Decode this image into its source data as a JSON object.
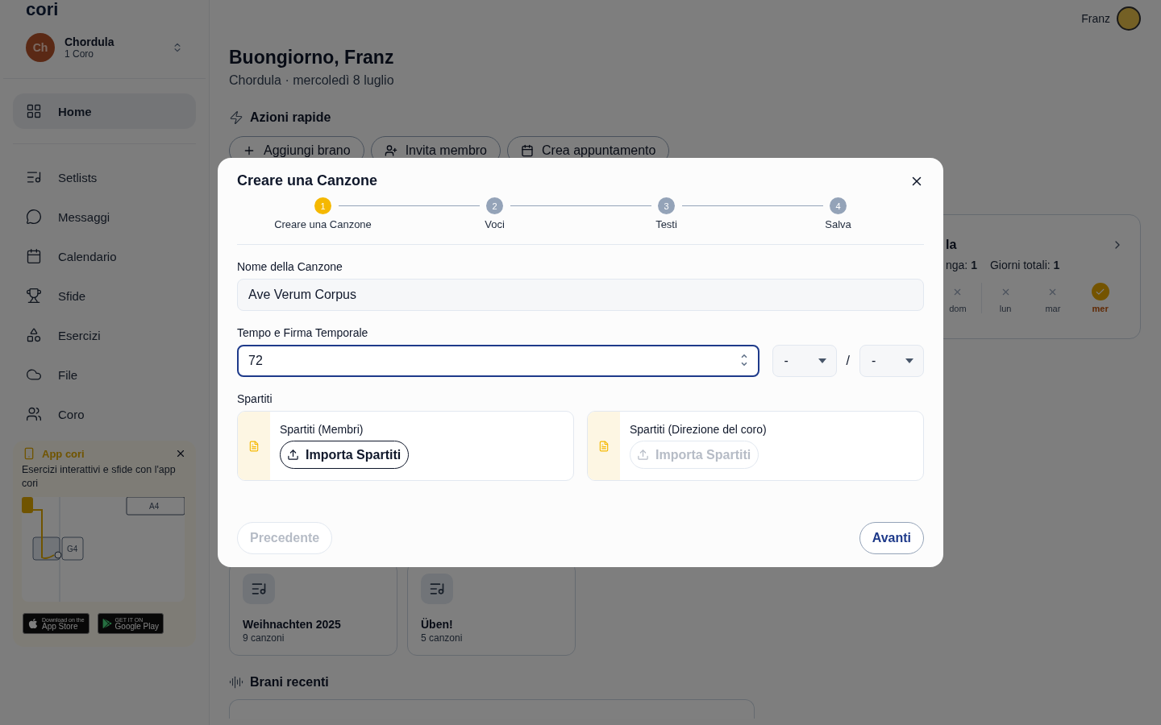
{
  "logo": "cori",
  "workspace": {
    "initials": "Ch",
    "name": "Chordula",
    "subtitle": "1 Coro"
  },
  "nav": [
    {
      "label": "Home",
      "selected": true
    },
    {
      "label": "Setlists",
      "selected": false
    },
    {
      "label": "Messaggi",
      "selected": false
    },
    {
      "label": "Calendario",
      "selected": false
    },
    {
      "label": "Sfide",
      "selected": false
    },
    {
      "label": "Esercizi",
      "selected": false
    },
    {
      "label": "File",
      "selected": false
    },
    {
      "label": "Coro",
      "selected": false
    }
  ],
  "promo": {
    "title": "App cori",
    "text": "Esercizi interattivi e sfide con l'app cori",
    "illustration_labels": [
      "A4",
      "G4"
    ],
    "stores": [
      {
        "kind": "apple",
        "small": "Download on the",
        "big": "App Store"
      },
      {
        "kind": "google",
        "small": "GET IT ON",
        "big": "Google Play"
      }
    ]
  },
  "user": {
    "name": "Franz"
  },
  "greeting": {
    "title": "Buongiorno, Franz",
    "subtitle": "Chordula · mercoledì 8 luglio"
  },
  "quick_actions": {
    "title": "Azioni rapide",
    "items": [
      {
        "label": "Aggiungi brano"
      },
      {
        "label": "Invita membro"
      },
      {
        "label": "Crea appuntamento"
      }
    ]
  },
  "streak": {
    "title": "la",
    "stats": [
      "nga: **1**",
      "Giorni totali: **1**"
    ],
    "days": [
      {
        "label": "dom",
        "done": false
      },
      {
        "label": "lun",
        "done": false
      },
      {
        "label": "mar",
        "done": false
      },
      {
        "label": "mer",
        "done": true
      }
    ]
  },
  "setlists": [
    {
      "name": "Weihnachten 2025",
      "count": "9 canzoni"
    },
    {
      "name": "Üben!",
      "count": "5 canzoni"
    }
  ],
  "recent": {
    "title": "Brani recenti"
  },
  "dialog": {
    "title": "Creare una Canzone",
    "steps": [
      {
        "number": "1",
        "label": "Creare una Canzone",
        "selected": true
      },
      {
        "number": "2",
        "label": "Voci",
        "selected": false
      },
      {
        "number": "3",
        "label": "Testi",
        "selected": false
      },
      {
        "number": "4",
        "label": "Salva",
        "selected": false
      }
    ],
    "name_field": {
      "label": "Nome della Canzone",
      "value": "Ave Verum Corpus"
    },
    "tempo": {
      "label": "Tempo e Firma Temporale",
      "value": "72",
      "focused": true,
      "numerator": "-",
      "separator": "/",
      "denominator": "-"
    },
    "scores": {
      "label": "Spartiti",
      "items": [
        {
          "title": "Spartiti (Membri)",
          "button": "Importa Spartiti",
          "disabled": false
        },
        {
          "title": "Spartiti (Direzione del coro)",
          "button": "Importa Spartiti",
          "disabled": true
        }
      ]
    },
    "buttons": [
      {
        "label": "Precedente",
        "disabled": true
      },
      {
        "label": "Avanti",
        "disabled": false
      }
    ]
  }
}
